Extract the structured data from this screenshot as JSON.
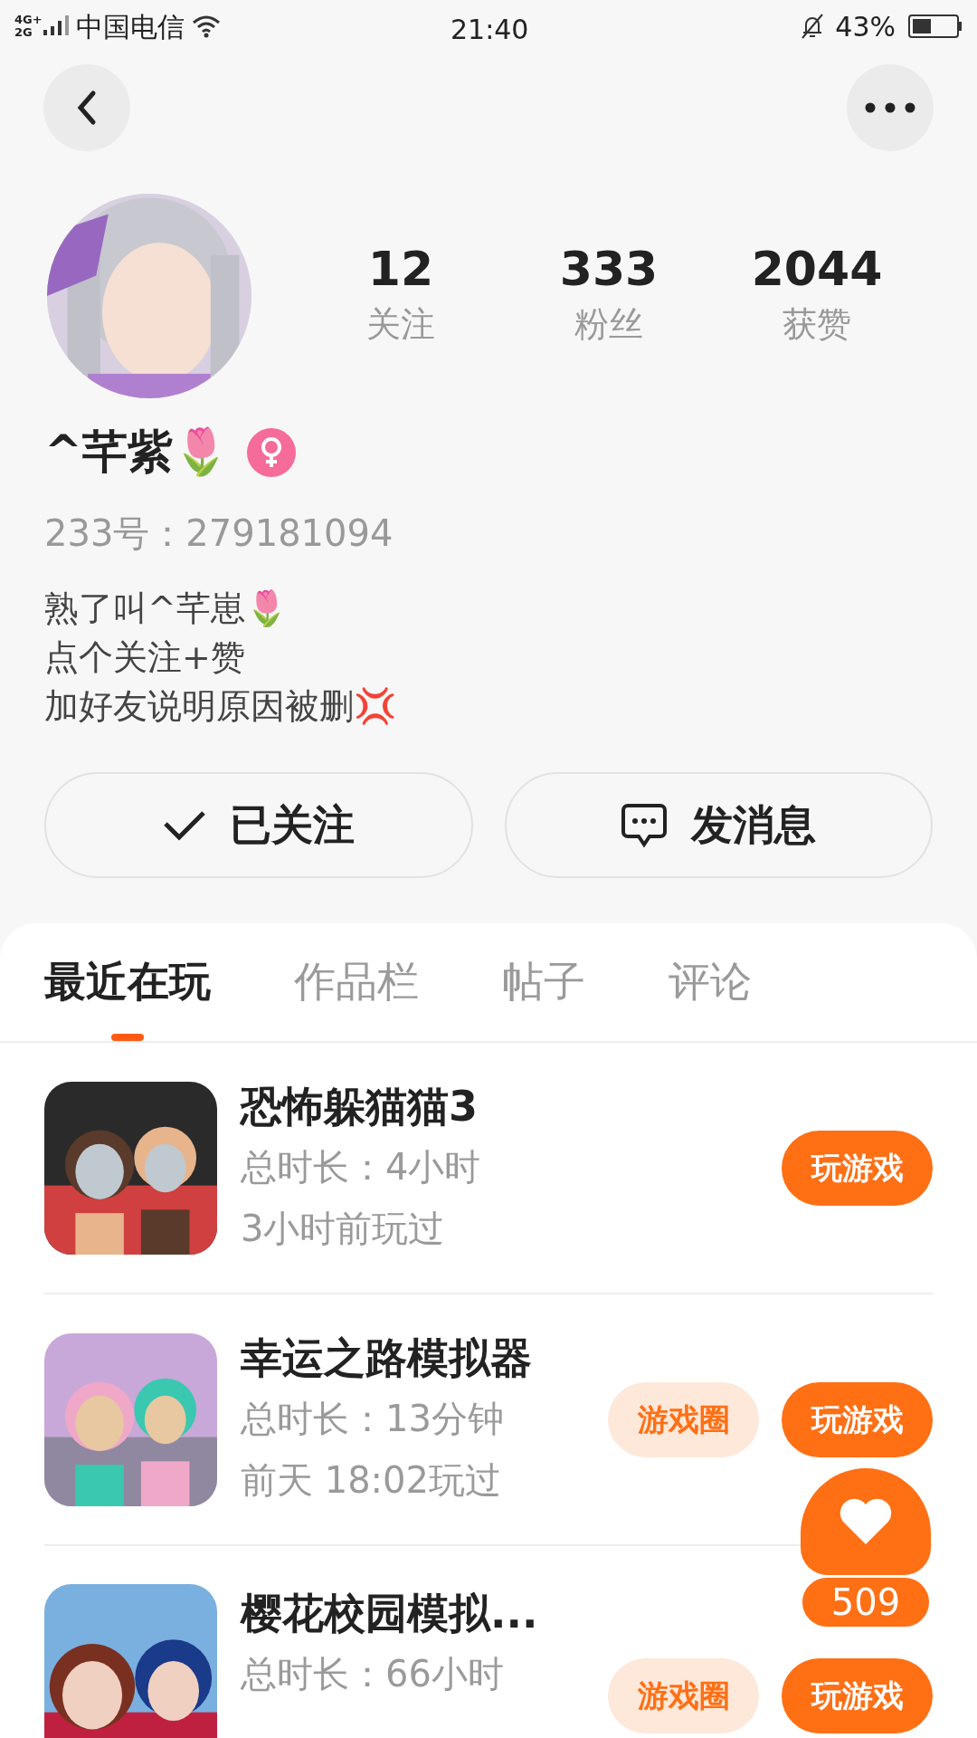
{
  "status_bar": {
    "network": "4G+ 2G",
    "carrier": "中国电信",
    "time": "21:40",
    "battery": "43%"
  },
  "profile": {
    "name": "^芊紫🌷",
    "gender_badge": {
      "kind": "female"
    },
    "id_line": "233号：279181094",
    "stats": [
      {
        "value": "12",
        "label": "关注"
      },
      {
        "value": "333",
        "label": "粉丝"
      },
      {
        "value": "2044",
        "label": "获赞"
      }
    ],
    "bio": [
      "熟了叫^芊崽🌷",
      "点个关注+赞",
      "加好友说明原因被删💢"
    ]
  },
  "actions": [
    {
      "kind": "follow",
      "label": "已关注"
    },
    {
      "kind": "message",
      "label": "发消息"
    }
  ],
  "tabs": [
    {
      "label": "最近在玩",
      "selected": true
    },
    {
      "label": "作品栏",
      "selected": false
    },
    {
      "label": "帖子",
      "selected": false
    },
    {
      "label": "评论",
      "selected": false
    }
  ],
  "games": [
    {
      "title": "恐怖躲猫猫3",
      "duration": "总时长：4小时",
      "last_played": "3小时前玩过",
      "buttons": [
        "玩游戏"
      ]
    },
    {
      "title": "幸运之路模拟器",
      "duration": "总时长：13分钟",
      "last_played": "前天 18:02玩过",
      "buttons": [
        "游戏圈",
        "玩游戏"
      ]
    },
    {
      "title": "樱花校园模拟...",
      "duration": "总时长：66小时",
      "buttons": [
        "游戏圈",
        "玩游戏"
      ]
    }
  ],
  "like_button": {
    "count": "509"
  }
}
